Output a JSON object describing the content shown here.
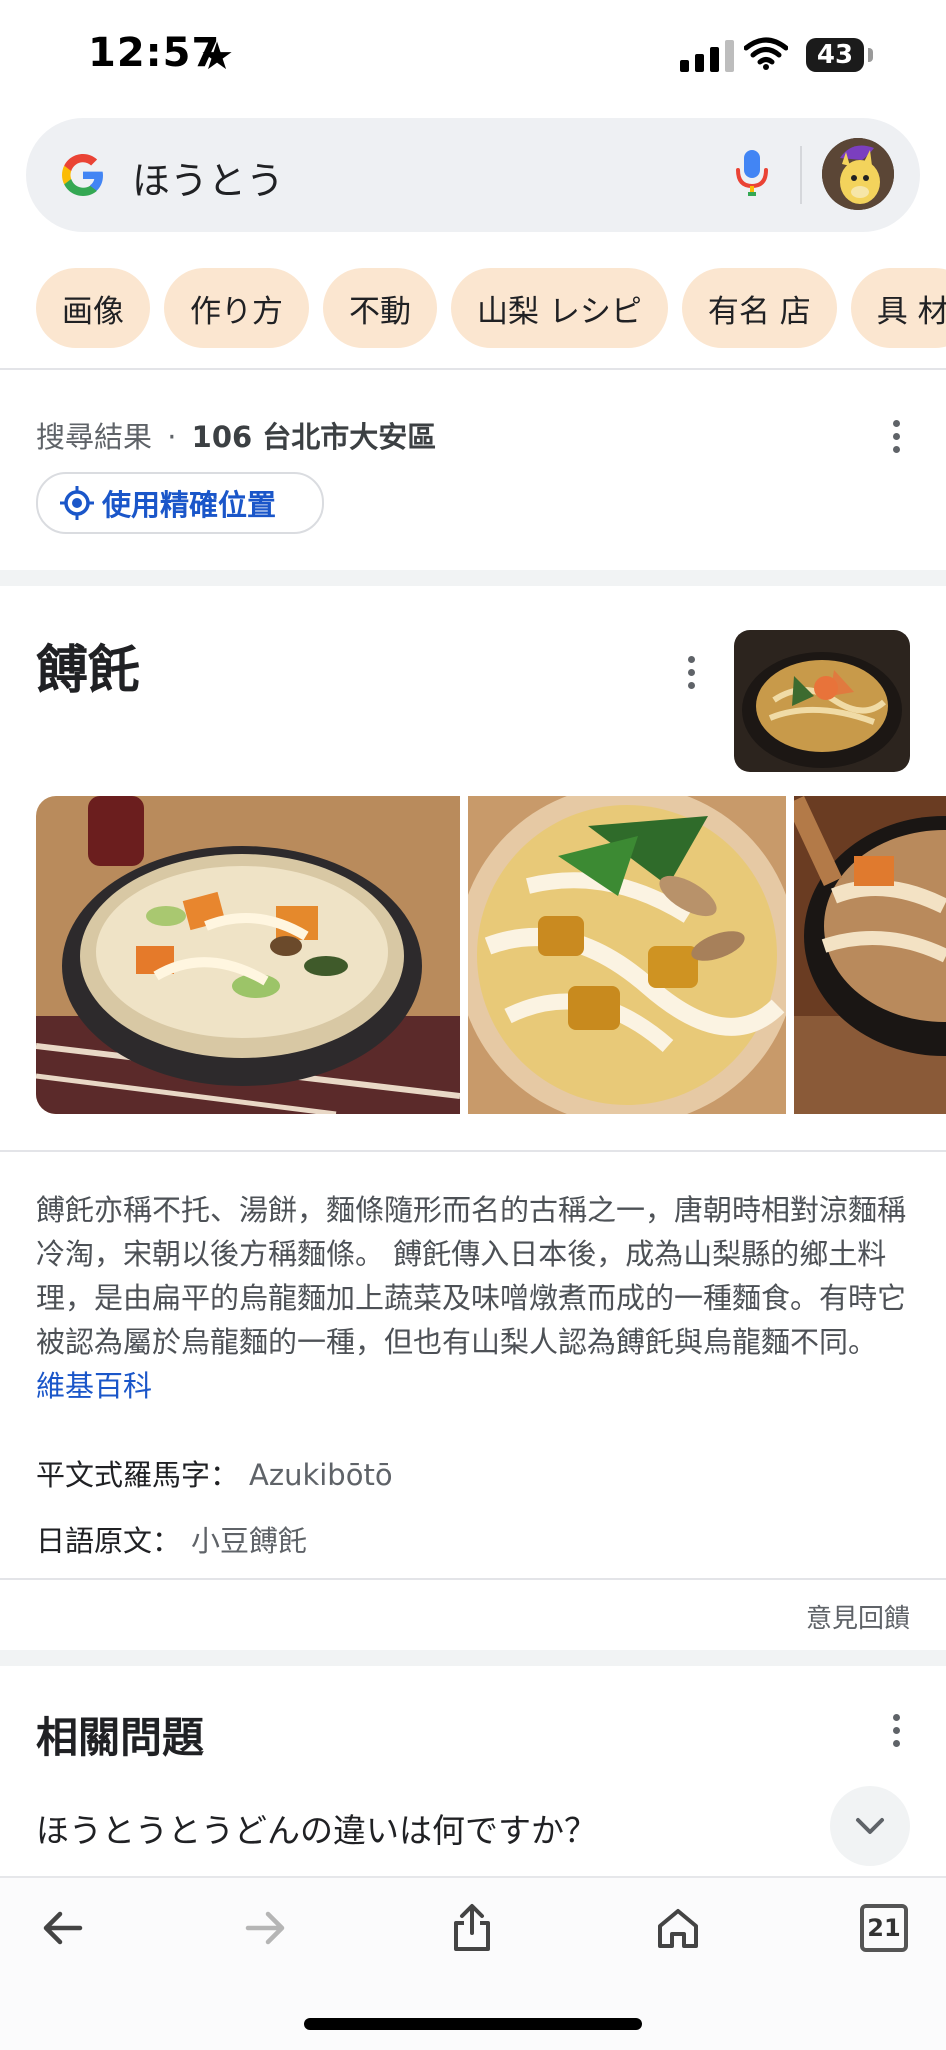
{
  "status_bar": {
    "time": "12:57",
    "battery": "43"
  },
  "search": {
    "query": "ほうとう"
  },
  "chips": [
    "画像",
    "作り方",
    "不動",
    "山梨 レシピ",
    "有名 店",
    "具 材"
  ],
  "location": {
    "label": "搜尋結果",
    "separator": "·",
    "place": "106 台北市大安區",
    "precise_button": "使用精確位置"
  },
  "knowledge_panel": {
    "title": "餺飥",
    "description": "餺飥亦稱不托、湯餅，麵條隨形而名的古稱之一，唐朝時相對涼麵稱冷淘，宋朝以後方稱麵條。 餺飥傳入日本後，成為山梨縣的鄉土料理，是由扁平的烏龍麵加上蔬菜及味噌燉煮而成的一種麵食。有時它被認為屬於烏龍麵的一種，但也有山梨人認為餺飥與烏龍麵不同。",
    "source_link": "維基百科",
    "facts": [
      {
        "label": "平文式羅馬字：",
        "value": "Azukibōtō"
      },
      {
        "label": "日語原文：",
        "value": "小豆餺飥"
      }
    ],
    "feedback": "意見回饋"
  },
  "related_questions": {
    "title": "相關問題",
    "items": [
      "ほうとうとうどんの違いは何ですか？"
    ]
  },
  "toolbar": {
    "tabs_count": "21"
  },
  "colors": {
    "chip_bg": "#fbe6d0",
    "link": "#1a56c9",
    "search_bg": "#eef0f3",
    "google_blue": "#4285f4",
    "google_red": "#ea4335",
    "google_yellow": "#fbbc05",
    "google_green": "#34a853"
  }
}
